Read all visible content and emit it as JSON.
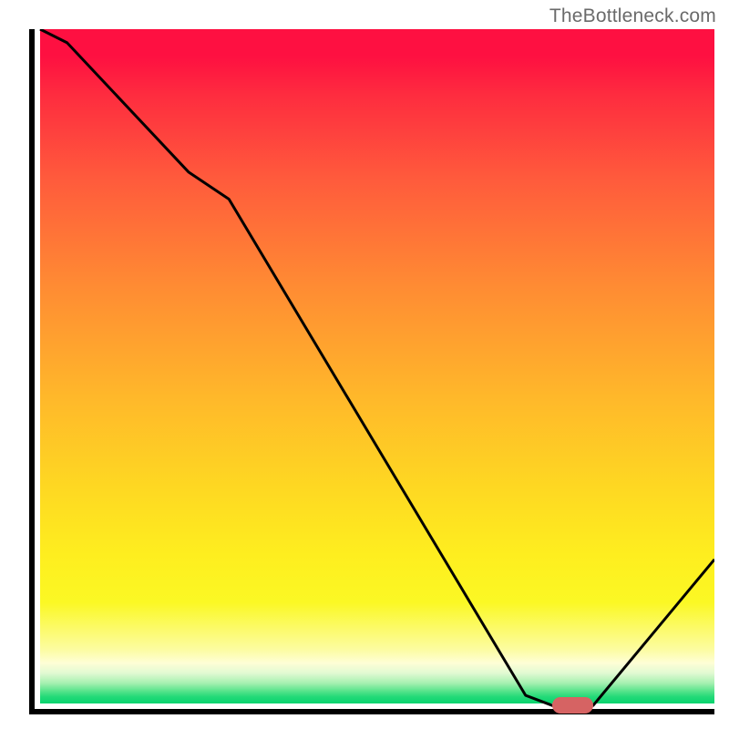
{
  "watermark": "TheBottleneck.com",
  "chart_data": {
    "type": "line",
    "title": "",
    "xlabel": "",
    "ylabel": "",
    "xlim": [
      0,
      100
    ],
    "ylim": [
      0,
      100
    ],
    "series": [
      {
        "name": "bottleneck-curve",
        "x": [
          0,
          4,
          22,
          28,
          72,
          76,
          82,
          100
        ],
        "values": [
          100,
          98,
          79,
          75,
          2,
          0.5,
          0.5,
          22
        ]
      }
    ],
    "marker": {
      "x_start": 76,
      "x_end": 82,
      "y": 0.5
    },
    "gradient_stops": [
      {
        "pct": 0,
        "color": "#fe1041"
      },
      {
        "pct": 22,
        "color": "#ff5a3c"
      },
      {
        "pct": 55,
        "color": "#ffb92a"
      },
      {
        "pct": 85,
        "color": "#fbf824"
      },
      {
        "pct": 100,
        "color": "#07d36e"
      }
    ]
  },
  "geom": {
    "plot_left": 32,
    "plot_top": 32,
    "plot_inner_w": 746,
    "plot_inner_h": 746,
    "inner_x_off": 6
  }
}
